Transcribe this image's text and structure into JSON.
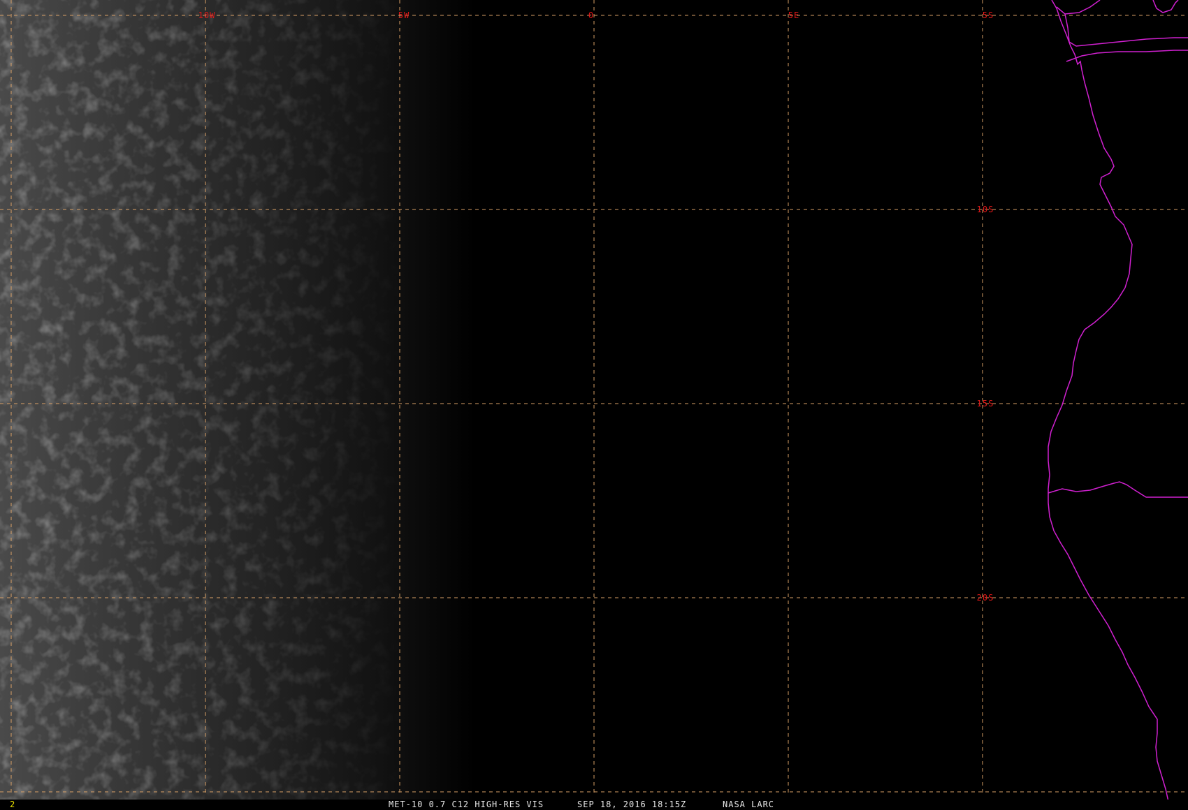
{
  "map": {
    "longitude_labels": [
      "10W",
      "5W",
      "0",
      "5E"
    ],
    "latitude_labels": [
      "5S",
      "10S",
      "15S",
      "20S"
    ],
    "grid_color": "#d9a066",
    "label_color": "#e01818",
    "coastline_color": "#d020d0",
    "background_color": "#000000"
  },
  "status": {
    "frame_number": "2",
    "product": "MET-10 0.7 C12 HIGH-RES VIS",
    "datetime": "SEP 18, 2016 18:15Z",
    "source": "NASA LARC"
  }
}
